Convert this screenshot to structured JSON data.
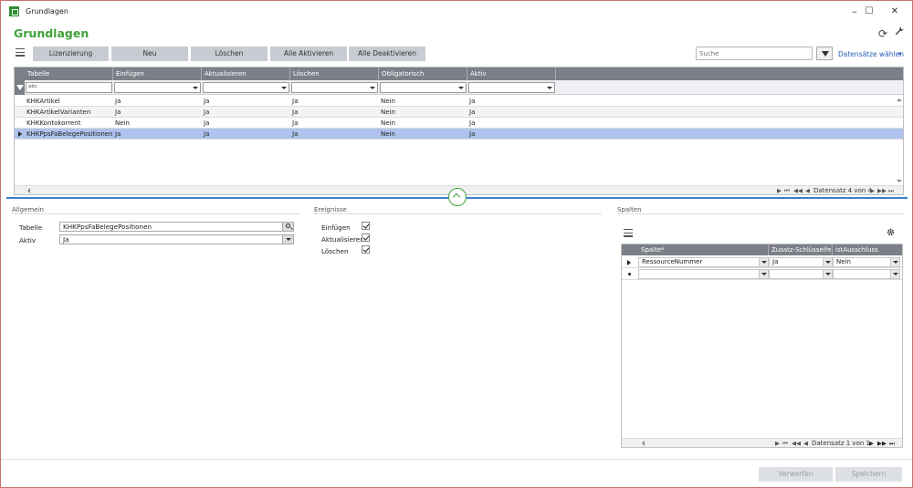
{
  "window": {
    "title": "Grundlagen",
    "minimize": "–",
    "maximize": "☐",
    "close": "✕"
  },
  "page": {
    "title": "Grundlagen",
    "refresh_glyph": "⟳",
    "wrench_glyph": "🔧"
  },
  "toolbar": {
    "buttons": [
      "Lizenzierung",
      "Neu",
      "Löschen",
      "Alle Aktivieren",
      "Alle Deaktivieren"
    ],
    "search_placeholder": "Suche",
    "datasets_label": "Datensätze wählen",
    "datasets_caret": "▾"
  },
  "main_grid": {
    "columns": [
      "Tabelle",
      "Einfügen",
      "Aktualisieren",
      "Löschen",
      "Obligatorisch",
      "Aktiv"
    ],
    "filter_text": "abc",
    "rows": [
      [
        "KHKArtikel",
        "Ja",
        "Ja",
        "Ja",
        "Nein",
        "Ja"
      ],
      [
        "KHKArtikelVarianten",
        "Ja",
        "Ja",
        "Ja",
        "Nein",
        "Ja"
      ],
      [
        "KHKKontokorrent",
        "Nein",
        "Ja",
        "Ja",
        "Nein",
        "Ja"
      ],
      [
        "KHKPpsFaBelegePositionen",
        "Ja",
        "Ja",
        "Ja",
        "Nein",
        "Ja"
      ]
    ],
    "selected_row": 3,
    "footer_text": "Datensatz 4 von 4",
    "nav_glyphs": {
      "first": "⏮",
      "prev_page": "◀◀",
      "prev": "◀",
      "next": "▶",
      "next_page": "▶▶",
      "last": "⏭"
    }
  },
  "allgemein": {
    "title": "Allgemein",
    "tabelle_label": "Tabelle",
    "tabelle_value": "KHKPpsFaBelegePositionen",
    "aktiv_label": "Aktiv",
    "aktiv_value": "Ja"
  },
  "ereignisse": {
    "title": "Ereignisse",
    "items": [
      {
        "label": "Einfügen",
        "checked": true
      },
      {
        "label": "Aktualisieren",
        "checked": true
      },
      {
        "label": "Löschen",
        "checked": true
      }
    ]
  },
  "spalten": {
    "title": "Spalten",
    "columns": [
      "Spalte*",
      "Zusatz-Schlüsselfeld",
      "istAusschluss"
    ],
    "rows": [
      [
        "RessourceNummer",
        "Ja",
        "Nein"
      ]
    ],
    "footer_text": "Datensatz 1 von 1"
  },
  "footer": {
    "discard_label": "Verwerfen",
    "save_label": "Speichern"
  }
}
